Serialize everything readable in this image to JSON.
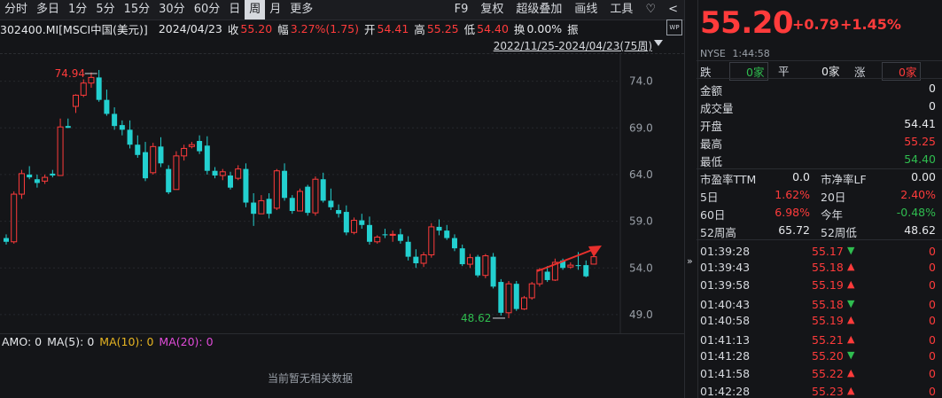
{
  "toolbar": {
    "left": [
      "分时",
      "多日",
      "1分",
      "5分",
      "15分",
      "30分",
      "60分",
      "日",
      "周",
      "月",
      "更多"
    ],
    "active": "周",
    "right": [
      "F9",
      "复权",
      "超级叠加",
      "画线",
      "工具",
      "♡",
      "<"
    ]
  },
  "info": {
    "code": "302400.MI[MSCI中国(美元)]",
    "date": "2024/04/23",
    "close_label": "收",
    "close": "55.20",
    "amp_label": "幅",
    "amp": "3.27%(1.75)",
    "open_label": "开",
    "open": "54.41",
    "high_label": "高",
    "high": "55.25",
    "low_label": "低",
    "low": "54.40",
    "turnover_label": "换",
    "turnover": "0.00%",
    "vib_label": "振"
  },
  "range": {
    "label": "2022/11/25-2024/04/23(75周)",
    "icon": "WP"
  },
  "chart_data": {
    "type": "candlestick",
    "period": "weekly",
    "ylim": [
      47.0,
      77.0
    ],
    "yticks": [
      "74.0",
      "69.0",
      "64.0",
      "59.0",
      "54.0",
      "49.0"
    ],
    "max_label": "74.94",
    "min_label": "48.62",
    "up_color": "#ff3b3b",
    "down_color": "#23d0d0",
    "candles": [
      [
        57.2,
        57.6,
        56.5,
        56.8
      ],
      [
        56.8,
        62.2,
        56.6,
        61.9
      ],
      [
        61.9,
        64.5,
        61.4,
        64.1
      ],
      [
        64.0,
        64.9,
        63.5,
        63.7
      ],
      [
        63.5,
        64.0,
        62.6,
        63.1
      ],
      [
        63.3,
        64.0,
        63.0,
        63.7
      ],
      [
        64.1,
        64.5,
        63.7,
        63.9
      ],
      [
        63.9,
        70.0,
        63.9,
        69.1
      ],
      [
        69.2,
        70.0,
        69.0,
        69.0
      ],
      [
        71.3,
        72.6,
        70.6,
        72.5
      ],
      [
        72.5,
        74.2,
        72.3,
        73.8
      ],
      [
        73.8,
        74.94,
        73.3,
        74.4
      ],
      [
        74.4,
        75.2,
        71.8,
        72.0
      ],
      [
        72.0,
        73.1,
        70.3,
        70.5
      ],
      [
        70.5,
        71.2,
        68.8,
        69.2
      ],
      [
        69.3,
        69.8,
        68.2,
        68.8
      ],
      [
        68.8,
        69.8,
        66.8,
        67.2
      ],
      [
        67.2,
        68.2,
        65.8,
        66.1
      ],
      [
        66.4,
        67.5,
        63.3,
        63.6
      ],
      [
        64.2,
        67.4,
        64.0,
        67.0
      ],
      [
        67.0,
        68.0,
        64.8,
        65.2
      ],
      [
        64.6,
        65.0,
        61.9,
        62.1
      ],
      [
        62.4,
        66.5,
        62.4,
        66.0
      ],
      [
        66.0,
        67.2,
        65.5,
        66.8
      ],
      [
        67.0,
        67.5,
        66.8,
        67.2
      ],
      [
        67.6,
        68.2,
        66.2,
        66.5
      ],
      [
        67.1,
        68.1,
        64.0,
        64.4
      ],
      [
        64.4,
        64.8,
        63.6,
        63.9
      ],
      [
        63.9,
        64.6,
        63.4,
        64.3
      ],
      [
        63.9,
        64.3,
        62.4,
        62.6
      ],
      [
        63.6,
        65.0,
        63.4,
        64.6
      ],
      [
        64.6,
        65.2,
        60.5,
        61.0
      ],
      [
        61.0,
        62.0,
        58.5,
        59.8
      ],
      [
        59.8,
        61.8,
        59.8,
        61.2
      ],
      [
        61.4,
        62.0,
        59.3,
        59.8
      ],
      [
        60.4,
        64.6,
        60.2,
        64.4
      ],
      [
        64.4,
        65.2,
        61.2,
        61.5
      ],
      [
        61.5,
        61.8,
        59.8,
        60.1
      ],
      [
        60.1,
        62.5,
        60.1,
        62.2
      ],
      [
        62.7,
        62.9,
        59.6,
        59.9
      ],
      [
        59.9,
        63.8,
        59.6,
        63.5
      ],
      [
        63.5,
        64.2,
        61.0,
        61.2
      ],
      [
        61.2,
        62.5,
        60.2,
        60.5
      ],
      [
        60.2,
        60.8,
        59.4,
        59.8
      ],
      [
        60.0,
        60.7,
        57.5,
        57.8
      ],
      [
        57.8,
        59.4,
        57.6,
        59.1
      ],
      [
        59.1,
        59.8,
        58.2,
        58.6
      ],
      [
        58.6,
        59.5,
        56.5,
        56.8
      ],
      [
        56.8,
        57.5,
        56.6,
        57.3
      ],
      [
        57.6,
        58.2,
        57.2,
        57.5
      ],
      [
        57.5,
        58.0,
        56.8,
        57.6
      ],
      [
        57.6,
        58.2,
        56.6,
        56.9
      ],
      [
        56.8,
        57.4,
        54.8,
        55.2
      ],
      [
        55.2,
        56.0,
        54.0,
        54.5
      ],
      [
        54.5,
        55.7,
        54.1,
        55.4
      ],
      [
        55.4,
        58.8,
        55.1,
        58.4
      ],
      [
        58.4,
        59.2,
        57.5,
        58.0
      ],
      [
        58.0,
        58.6,
        57.0,
        57.2
      ],
      [
        57.2,
        57.6,
        55.8,
        56.1
      ],
      [
        56.1,
        56.5,
        54.2,
        54.4
      ],
      [
        54.4,
        55.5,
        54.0,
        55.1
      ],
      [
        55.2,
        55.4,
        53.0,
        53.2
      ],
      [
        53.2,
        55.5,
        52.9,
        55.3
      ],
      [
        55.2,
        55.6,
        51.8,
        52.0
      ],
      [
        52.5,
        52.8,
        48.9,
        49.2
      ],
      [
        49.2,
        52.6,
        48.62,
        52.3
      ],
      [
        52.3,
        52.6,
        49.4,
        49.6
      ],
      [
        49.6,
        51.0,
        49.5,
        50.8
      ],
      [
        50.8,
        52.5,
        50.6,
        52.3
      ],
      [
        52.3,
        54.0,
        52.0,
        53.8
      ],
      [
        53.6,
        54.2,
        52.5,
        52.7
      ],
      [
        52.7,
        55.0,
        52.6,
        54.6
      ],
      [
        54.8,
        55.0,
        53.8,
        54.0
      ],
      [
        54.1,
        54.6,
        53.9,
        54.3
      ],
      [
        54.3,
        55.7,
        53.8,
        54.2
      ],
      [
        54.3,
        54.8,
        53.0,
        53.1
      ],
      [
        54.41,
        55.25,
        54.4,
        55.2
      ]
    ]
  },
  "indicators": {
    "amo": "AMO: 0",
    "ma5": "MA(5): 0",
    "ma10": "MA(10): 0",
    "ma20": "MA(20): 0",
    "nodata": "当前暂无相关数据"
  },
  "quote": {
    "price": "55.20",
    "change": "+0.79",
    "change_pct": "+1.45%",
    "exchange": "NYSE",
    "time": "1:44:58",
    "fall_label": "跌",
    "fall": "0家",
    "flat_label": "平",
    "flat": "0家",
    "rise_label": "涨",
    "rise": "0家"
  },
  "stats": [
    {
      "label": "金额",
      "value": "0",
      "color": "white"
    },
    {
      "label": "成交量",
      "value": "0",
      "color": "white"
    },
    {
      "label": "开盘",
      "value": "54.41",
      "color": "white"
    },
    {
      "label": "最高",
      "value": "55.25",
      "color": "red"
    },
    {
      "label": "最低",
      "value": "54.40",
      "color": "green"
    }
  ],
  "valuation": [
    {
      "l1": "市盈率TTM",
      "v1": "0.0",
      "c1": "white",
      "l2": "市净率LF",
      "v2": "0.00",
      "c2": "white"
    },
    {
      "l1": "5日",
      "v1": "1.62%",
      "c1": "red",
      "l2": "20日",
      "v2": "2.40%",
      "c2": "red"
    },
    {
      "l1": "60日",
      "v1": "6.98%",
      "c1": "red",
      "l2": "今年",
      "v2": "-0.48%",
      "c2": "green"
    },
    {
      "l1": "52周高",
      "v1": "65.72",
      "c1": "white",
      "l2": "52周低",
      "v2": "48.62",
      "c2": "white"
    }
  ],
  "ticks": [
    {
      "time": "01:39:28",
      "price": "55.17",
      "dir": "down",
      "vol": "0"
    },
    {
      "time": "01:39:43",
      "price": "55.18",
      "dir": "up",
      "vol": "0"
    },
    {
      "time": "01:39:58",
      "price": "55.19",
      "dir": "up",
      "vol": "0"
    },
    {
      "time": "01:40:43",
      "price": "55.18",
      "dir": "down",
      "vol": "0"
    },
    {
      "time": "01:40:58",
      "price": "55.19",
      "dir": "up",
      "vol": "0"
    },
    {
      "time": "01:41:13",
      "price": "55.21",
      "dir": "up",
      "vol": "0"
    },
    {
      "time": "01:41:28",
      "price": "55.20",
      "dir": "down",
      "vol": "0"
    },
    {
      "time": "01:41:58",
      "price": "55.22",
      "dir": "up",
      "vol": "0"
    },
    {
      "time": "01:42:28",
      "price": "55.23",
      "dir": "up",
      "vol": "0"
    }
  ]
}
